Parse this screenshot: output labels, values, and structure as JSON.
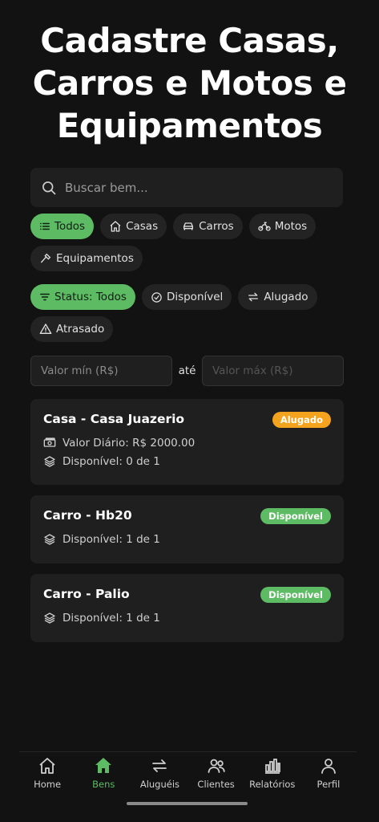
{
  "page": {
    "title": "Cadastre Casas, Carros e Motos e Equipamentos"
  },
  "search": {
    "placeholder": "Buscar bem..."
  },
  "categories": [
    {
      "label": "Todos",
      "icon": "list-icon",
      "active": true
    },
    {
      "label": "Casas",
      "icon": "house-icon",
      "active": false
    },
    {
      "label": "Carros",
      "icon": "car-icon",
      "active": false
    },
    {
      "label": "Motos",
      "icon": "motorcycle-icon",
      "active": false
    },
    {
      "label": "Equipamentos",
      "icon": "hammer-icon",
      "active": false
    }
  ],
  "statuses": [
    {
      "label": "Status: Todos",
      "icon": "filter-icon",
      "active": true
    },
    {
      "label": "Disponível",
      "icon": "check-circle-icon",
      "active": false
    },
    {
      "label": "Alugado",
      "icon": "swap-icon",
      "active": false
    },
    {
      "label": "Atrasado",
      "icon": "warning-icon",
      "active": false
    }
  ],
  "price_range": {
    "min_placeholder": "Valor mín (R$)",
    "separator": "até",
    "max_placeholder": "Valor máx (R$)"
  },
  "items": [
    {
      "title": "Casa - Casa Juazerio",
      "status": "Alugado",
      "daily": "Valor Diário: R$ 2000.00",
      "availability": "Disponível: 0 de 1"
    },
    {
      "title": "Carro - Hb20",
      "status": "Disponível",
      "availability": "Disponível: 1 de 1"
    },
    {
      "title": "Carro - Palio",
      "status": "Disponível",
      "availability": "Disponível: 1 de 1"
    }
  ],
  "nav": [
    {
      "label": "Home",
      "icon": "home-icon"
    },
    {
      "label": "Bens",
      "icon": "home-filled-icon",
      "active": true
    },
    {
      "label": "Aluguéis",
      "icon": "swap-icon"
    },
    {
      "label": "Clientes",
      "icon": "users-icon"
    },
    {
      "label": "Relatórios",
      "icon": "bar-chart-icon"
    },
    {
      "label": "Perfil",
      "icon": "person-icon"
    }
  ],
  "colors": {
    "accent": "#5dbb63",
    "rented": "#f3a31d",
    "background": "#121212",
    "card": "#1f1f1f"
  }
}
